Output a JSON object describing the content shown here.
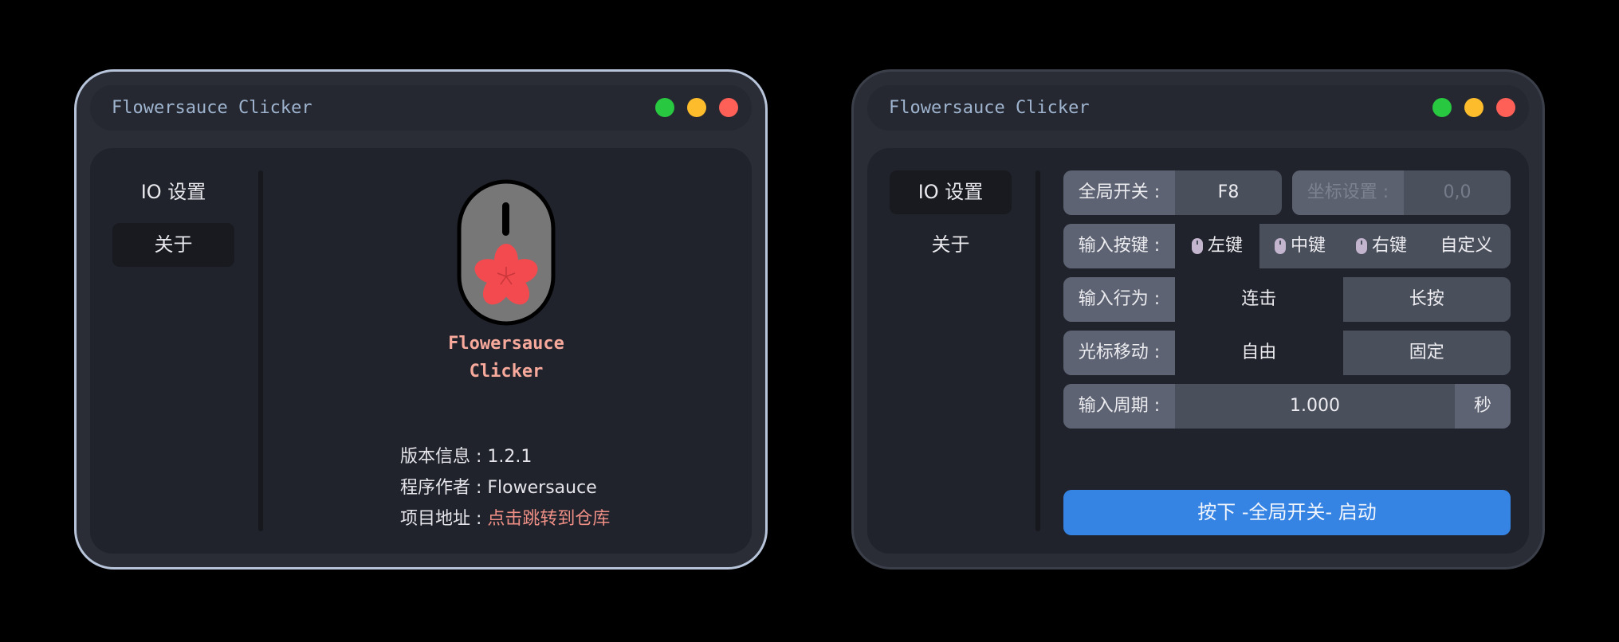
{
  "windows": [
    {
      "title": "Flowersauce Clicker",
      "sidebar": [
        "IO 设置",
        "关于"
      ],
      "about": {
        "app_name_line1": "Flowersauce",
        "app_name_line2": "Clicker",
        "version_label": "版本信息 : ",
        "version_value": "1.2.1",
        "author_label": "程序作者 : ",
        "author_value": "Flowersauce",
        "repo_label": "项目地址 : ",
        "repo_link": "点击跳转到仓库"
      }
    },
    {
      "title": "Flowersauce Clicker",
      "sidebar": [
        "IO 设置",
        "关于"
      ],
      "io": {
        "global_switch_label": "全局开关 :",
        "global_switch_value": "F8",
        "coord_label": "坐标设置 :",
        "coord_value": "0,0",
        "input_key_label": "输入按键 :",
        "keys": [
          "左键",
          "中键",
          "右键",
          "自定义"
        ],
        "input_action_label": "输入行为 :",
        "actions": [
          "连击",
          "长按"
        ],
        "cursor_label": "光标移动 :",
        "cursor_options": [
          "自由",
          "固定"
        ],
        "period_label": "输入周期 :",
        "period_value": "1.000",
        "period_unit": "秒",
        "start_button": "按下 -全局开关- 启动"
      }
    }
  ],
  "colors": {
    "accent_blue": "#3584e4",
    "traffic_green": "#28c841",
    "traffic_yellow": "#fdbc2c",
    "traffic_red": "#fe5f57",
    "app_name": "#f7a99c",
    "link": "#ef8f86"
  },
  "icons": [
    "mouse-sakura-logo",
    "mouse-icon"
  ]
}
